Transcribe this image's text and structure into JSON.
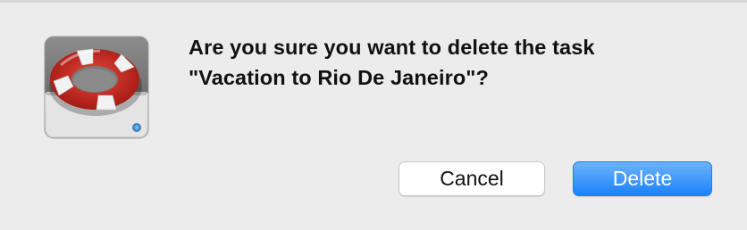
{
  "dialog": {
    "message_line1": "Are you sure you want to delete the task",
    "message_line2": "\"Vacation to Rio De Janeiro\"?",
    "icon": "lifebuoy-drive-icon"
  },
  "buttons": {
    "cancel_label": "Cancel",
    "delete_label": "Delete"
  },
  "colors": {
    "primary_button": "#1a82fb",
    "background": "#ececec"
  }
}
